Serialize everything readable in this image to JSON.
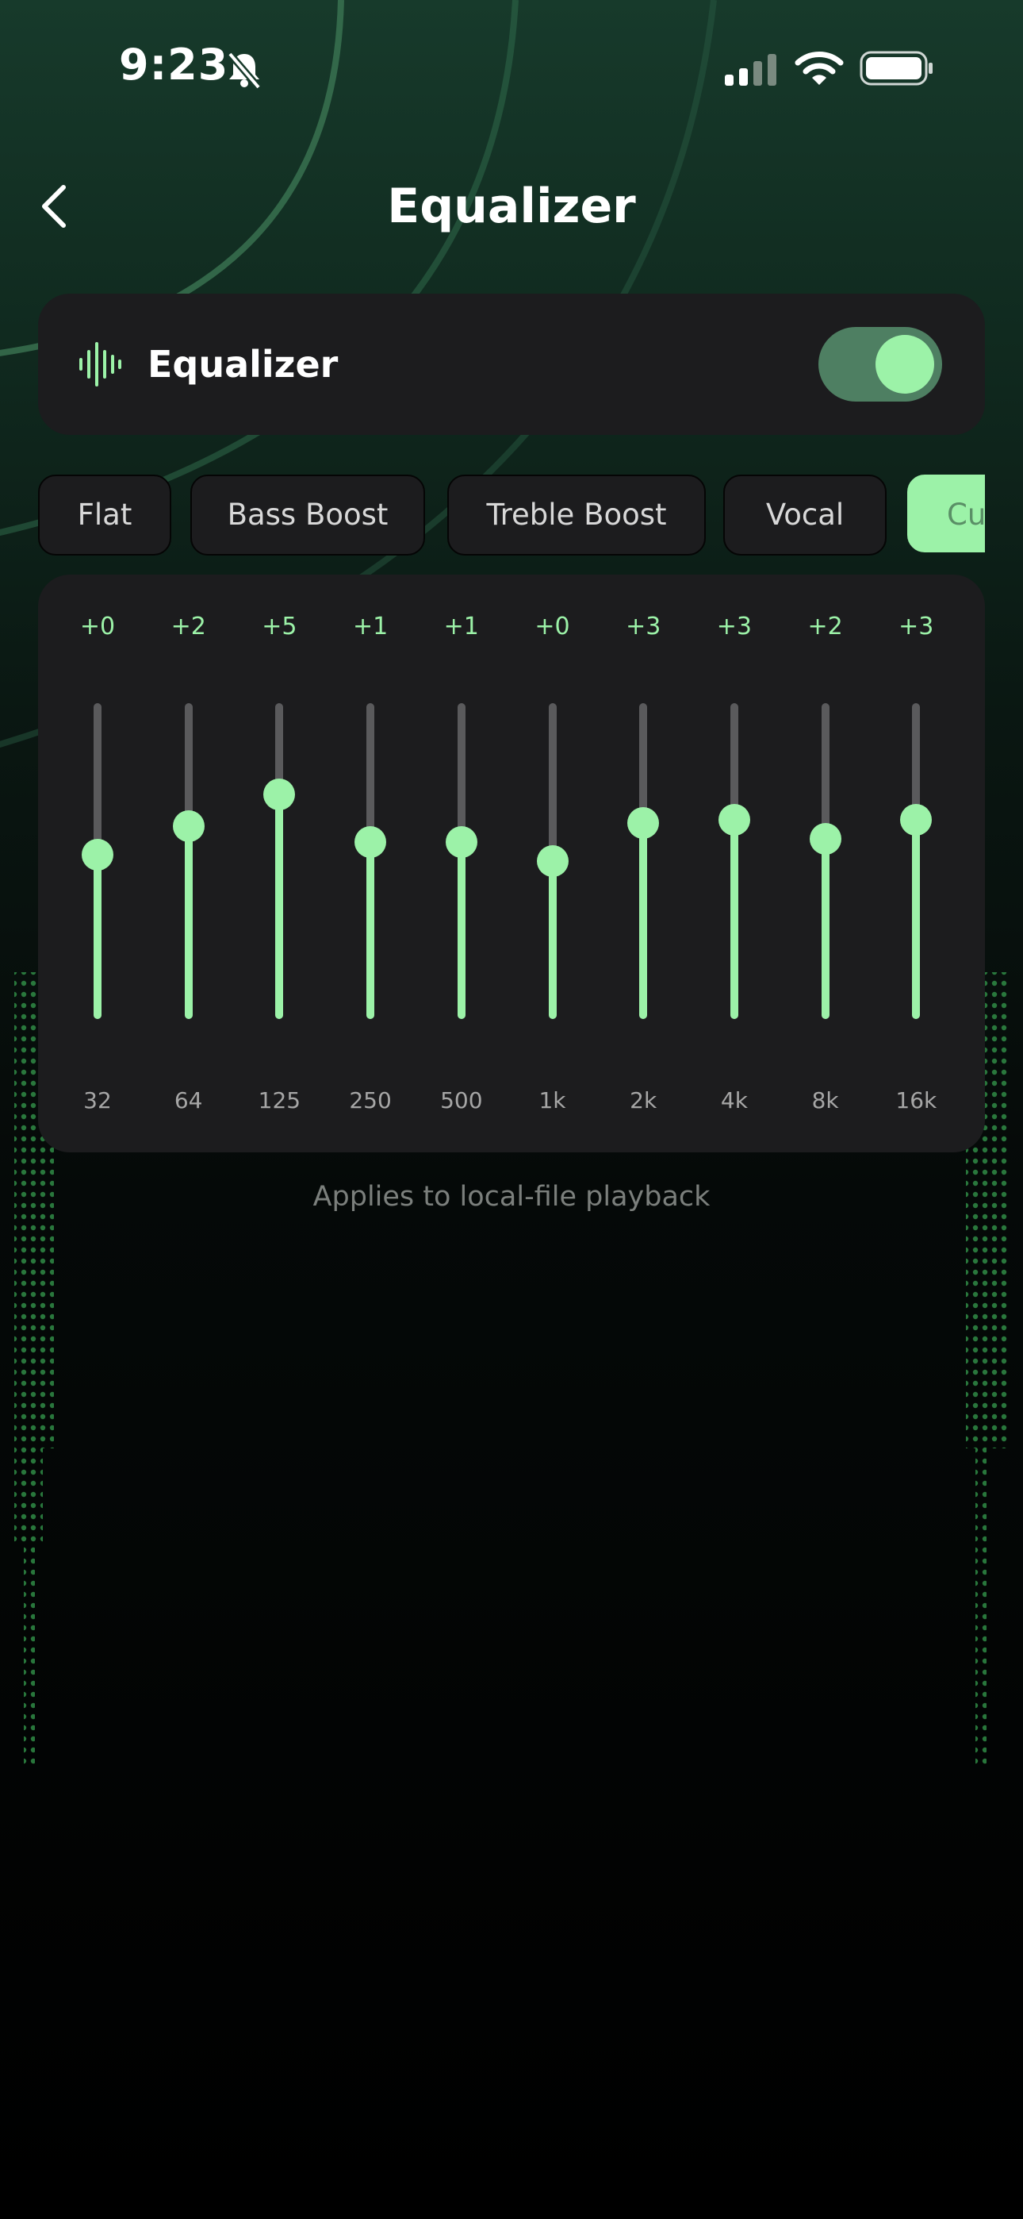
{
  "status_bar": {
    "time": "9:23",
    "icons": [
      "bell-slash-icon",
      "cellular-signal-icon",
      "wifi-icon",
      "battery-icon"
    ]
  },
  "header": {
    "title": "Equalizer",
    "back_icon": "chevron-left-icon"
  },
  "toggle_card": {
    "icon": "audio-waveform-icon",
    "label": "Equalizer",
    "enabled": true
  },
  "presets": [
    {
      "label": "Flat",
      "active": false
    },
    {
      "label": "Bass Boost",
      "active": false
    },
    {
      "label": "Treble Boost",
      "active": false
    },
    {
      "label": "Vocal",
      "active": false
    },
    {
      "label": "Cu",
      "active": true
    }
  ],
  "bands": [
    {
      "freq": "32",
      "gain_label": "+0",
      "level": 0.52
    },
    {
      "freq": "64",
      "gain_label": "+2",
      "level": 0.61
    },
    {
      "freq": "125",
      "gain_label": "+5",
      "level": 0.71
    },
    {
      "freq": "250",
      "gain_label": "+1",
      "level": 0.56
    },
    {
      "freq": "500",
      "gain_label": "+1",
      "level": 0.56
    },
    {
      "freq": "1k",
      "gain_label": "+0",
      "level": 0.5
    },
    {
      "freq": "2k",
      "gain_label": "+3",
      "level": 0.62
    },
    {
      "freq": "4k",
      "gain_label": "+3",
      "level": 0.63
    },
    {
      "freq": "8k",
      "gain_label": "+2",
      "level": 0.57
    },
    {
      "freq": "16k",
      "gain_label": "+3",
      "level": 0.63
    }
  ],
  "footnote": "Applies to local-file playback",
  "colors": {
    "accent": "#9cf2a8",
    "card": "#1c1c1e",
    "toggle_track": "#4e7f62",
    "background_top": "#173a2b"
  }
}
